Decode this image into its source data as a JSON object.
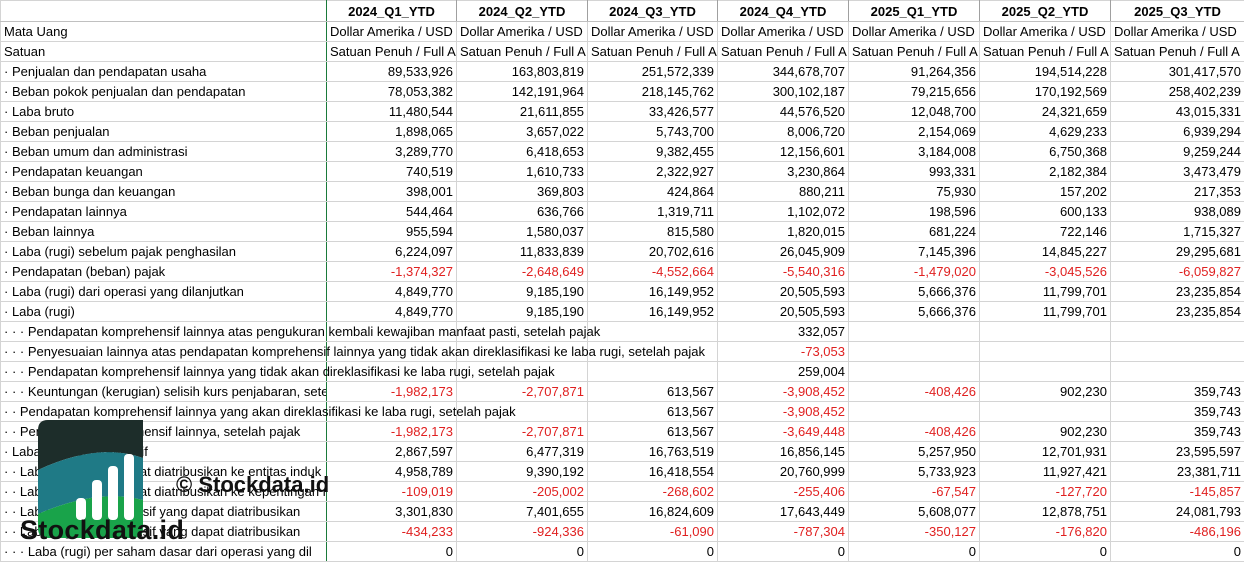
{
  "sheet": {
    "columns": [
      "2024_Q1_YTD",
      "2024_Q2_YTD",
      "2024_Q3_YTD",
      "2024_Q4_YTD",
      "2025_Q1_YTD",
      "2025_Q2_YTD",
      "2025_Q3_YTD"
    ],
    "rows": [
      {
        "label": "Mata Uang",
        "values": [
          "Dollar Amerika / USD",
          "Dollar Amerika / USD",
          "Dollar Amerika / USD",
          "Dollar Amerika / USD",
          "Dollar Amerika / USD",
          "Dollar Amerika / USD",
          "Dollar Amerika / USD"
        ],
        "kind": "text"
      },
      {
        "label": "Satuan",
        "values": [
          "Satuan Penuh / Full A",
          "Satuan Penuh / Full A",
          "Satuan Penuh / Full A",
          "Satuan Penuh / Full A",
          "Satuan Penuh / Full A",
          "Satuan Penuh / Full A",
          "Satuan Penuh / Full A"
        ],
        "kind": "text"
      },
      {
        "label": "· Penjualan dan pendapatan usaha",
        "values": [
          "89,533,926",
          "163,803,819",
          "251,572,339",
          "344,678,707",
          "91,264,356",
          "194,514,228",
          "301,417,570"
        ]
      },
      {
        "label": "· Beban pokok penjualan dan pendapatan",
        "values": [
          "78,053,382",
          "142,191,964",
          "218,145,762",
          "300,102,187",
          "79,215,656",
          "170,192,569",
          "258,402,239"
        ]
      },
      {
        "label": "· Laba bruto",
        "values": [
          "11,480,544",
          "21,611,855",
          "33,426,577",
          "44,576,520",
          "12,048,700",
          "24,321,659",
          "43,015,331"
        ]
      },
      {
        "label": "· Beban penjualan",
        "values": [
          "1,898,065",
          "3,657,022",
          "5,743,700",
          "8,006,720",
          "2,154,069",
          "4,629,233",
          "6,939,294"
        ]
      },
      {
        "label": "· Beban umum dan administrasi",
        "values": [
          "3,289,770",
          "6,418,653",
          "9,382,455",
          "12,156,601",
          "3,184,008",
          "6,750,368",
          "9,259,244"
        ]
      },
      {
        "label": "· Pendapatan keuangan",
        "values": [
          "740,519",
          "1,610,733",
          "2,322,927",
          "3,230,864",
          "993,331",
          "2,182,384",
          "3,473,479"
        ]
      },
      {
        "label": "· Beban bunga dan keuangan",
        "values": [
          "398,001",
          "369,803",
          "424,864",
          "880,211",
          "75,930",
          "157,202",
          "217,353"
        ]
      },
      {
        "label": "· Pendapatan lainnya",
        "values": [
          "544,464",
          "636,766",
          "1,319,711",
          "1,102,072",
          "198,596",
          "600,133",
          "938,089"
        ]
      },
      {
        "label": "· Beban lainnya",
        "values": [
          "955,594",
          "1,580,037",
          "815,580",
          "1,820,015",
          "681,224",
          "722,146",
          "1,715,327"
        ]
      },
      {
        "label": "· Laba (rugi) sebelum pajak penghasilan",
        "values": [
          "6,224,097",
          "11,833,839",
          "20,702,616",
          "26,045,909",
          "7,145,396",
          "14,845,227",
          "29,295,681"
        ]
      },
      {
        "label": "· Pendapatan (beban) pajak",
        "values": [
          "-1,374,327",
          "-2,648,649",
          "-4,552,664",
          "-5,540,316",
          "-1,479,020",
          "-3,045,526",
          "-6,059,827"
        ]
      },
      {
        "label": "· Laba (rugi) dari operasi yang dilanjutkan",
        "values": [
          "4,849,770",
          "9,185,190",
          "16,149,952",
          "20,505,593",
          "5,666,376",
          "11,799,701",
          "23,235,854"
        ]
      },
      {
        "label": "· Laba (rugi)",
        "values": [
          "4,849,770",
          "9,185,190",
          "16,149,952",
          "20,505,593",
          "5,666,376",
          "11,799,701",
          "23,235,854"
        ]
      },
      {
        "label": "· · · Pendapatan komprehensif lainnya atas pengukuran kembali kewajiban manfaat pasti, setelah pajak",
        "values": [
          "",
          "",
          "",
          "332,057",
          "",
          "",
          ""
        ],
        "overflow": true
      },
      {
        "label": "· · · Penyesuaian lainnya atas pendapatan komprehensif lainnya yang tidak akan direklasifikasi ke laba rugi, setelah pajak",
        "values": [
          "",
          "",
          "",
          "-73,053",
          "",
          "",
          ""
        ],
        "overflow": true
      },
      {
        "label": "· · · Pendapatan komprehensif lainnya yang tidak akan direklasifikasi ke laba rugi, setelah pajak",
        "values": [
          "",
          "",
          "",
          "259,004",
          "",
          "",
          ""
        ],
        "overflow": true
      },
      {
        "label": "· · · Keuntungan (kerugian) selisih kurs penjabaran, setelah pajak",
        "values": [
          "-1,982,173",
          "-2,707,871",
          "613,567",
          "-3,908,452",
          "-408,426",
          "902,230",
          "359,743"
        ]
      },
      {
        "label": "· · Pendapatan komprehensif lainnya yang akan direklasifikasi ke laba rugi, setelah pajak",
        "values": [
          "",
          "",
          "613,567",
          "-3,908,452",
          "",
          "",
          "359,743"
        ],
        "overflow": true
      },
      {
        "label": "· · Pendapatan komprehensif lainnya, setelah pajak",
        "values": [
          "-1,982,173",
          "-2,707,871",
          "613,567",
          "-3,649,448",
          "-408,426",
          "902,230",
          "359,743"
        ]
      },
      {
        "label": "· Laba rugi komprehensif",
        "values": [
          "2,867,597",
          "6,477,319",
          "16,763,519",
          "16,856,145",
          "5,257,950",
          "12,701,931",
          "23,595,597"
        ]
      },
      {
        "label": "· · Laba (rugi) yang dapat diatribusikan ke entitas induk",
        "values": [
          "4,958,789",
          "9,390,192",
          "16,418,554",
          "20,760,999",
          "5,733,923",
          "11,927,421",
          "23,381,711"
        ]
      },
      {
        "label": "· · Laba (rugi) yang dapat diatribusikan ke kepentingan non-pengendali",
        "values": [
          "-109,019",
          "-205,002",
          "-268,602",
          "-255,406",
          "-67,547",
          "-127,720",
          "-145,857"
        ]
      },
      {
        "label": "· · Laba rugi komprehensif yang dapat diatribusikan",
        "values": [
          "3,301,830",
          "7,401,655",
          "16,824,609",
          "17,643,449",
          "5,608,077",
          "12,878,751",
          "24,081,793"
        ]
      },
      {
        "label": "· · Laba rugi komprehensif yang dapat diatribusikan",
        "values": [
          "-434,233",
          "-924,336",
          "-61,090",
          "-787,304",
          "-350,127",
          "-176,820",
          "-486,196"
        ]
      },
      {
        "label": "· · · Laba (rugi) per saham dasar dari operasi yang dil",
        "values": [
          "0",
          "0",
          "0",
          "0",
          "0",
          "0",
          "0"
        ]
      }
    ]
  },
  "watermark": {
    "caption": "© Stockdata.id",
    "brand": "Stockdata.id",
    "colors": {
      "dark": "#1d2d2a",
      "teal": "#1f7a86",
      "green": "#19a34a",
      "white": "#ffffff"
    }
  }
}
